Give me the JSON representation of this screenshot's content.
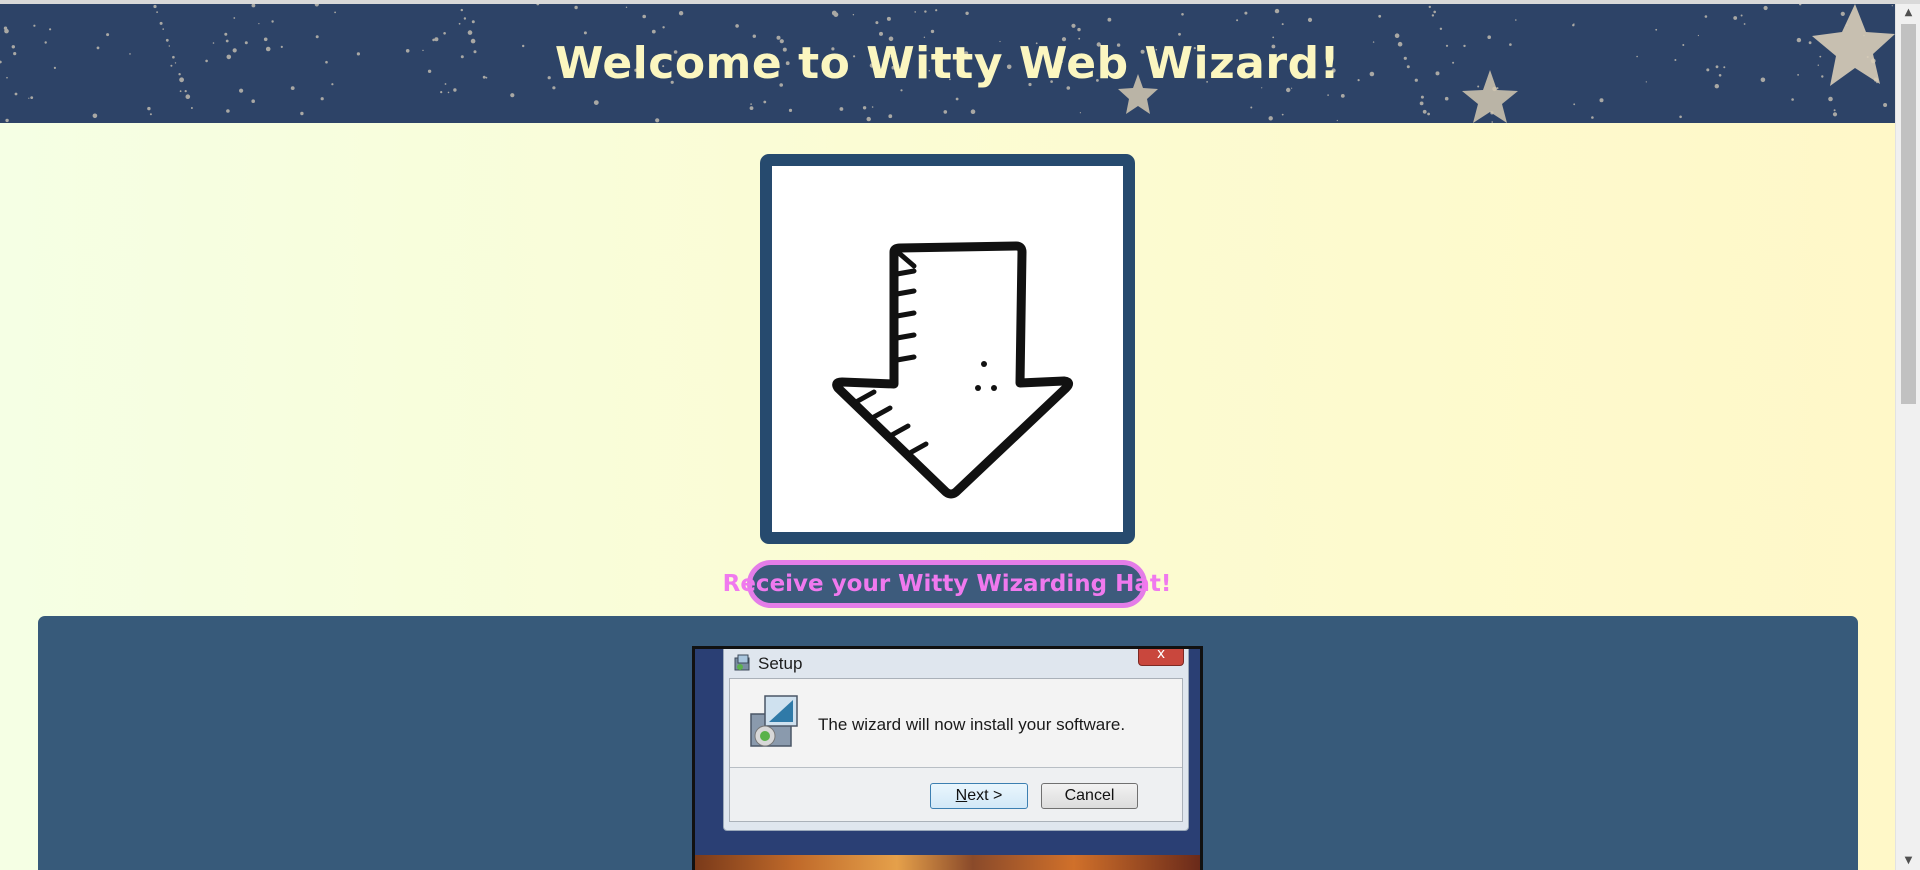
{
  "header": {
    "title": "Welcome to Witty Web Wizard!"
  },
  "arrow_card": {
    "icon": "down-arrow-icon"
  },
  "hat_link": {
    "label": "Receive your Witty Wizarding Hat!"
  },
  "setup_dialog": {
    "title": "Setup",
    "close_label": "x",
    "message": "The wizard will now install your software.",
    "next_label_prefix": "N",
    "next_label_rest": "ext >",
    "cancel_label": "Cancel"
  },
  "scrollbar": {
    "up_icon": "▲",
    "down_icon": "▼"
  },
  "colors": {
    "banner": "#2d4367",
    "title_text": "#fbf6c0",
    "card_border": "#264a6e",
    "panel": "#375a7a",
    "link_text": "#f079ee",
    "link_border": "#e47de8"
  }
}
